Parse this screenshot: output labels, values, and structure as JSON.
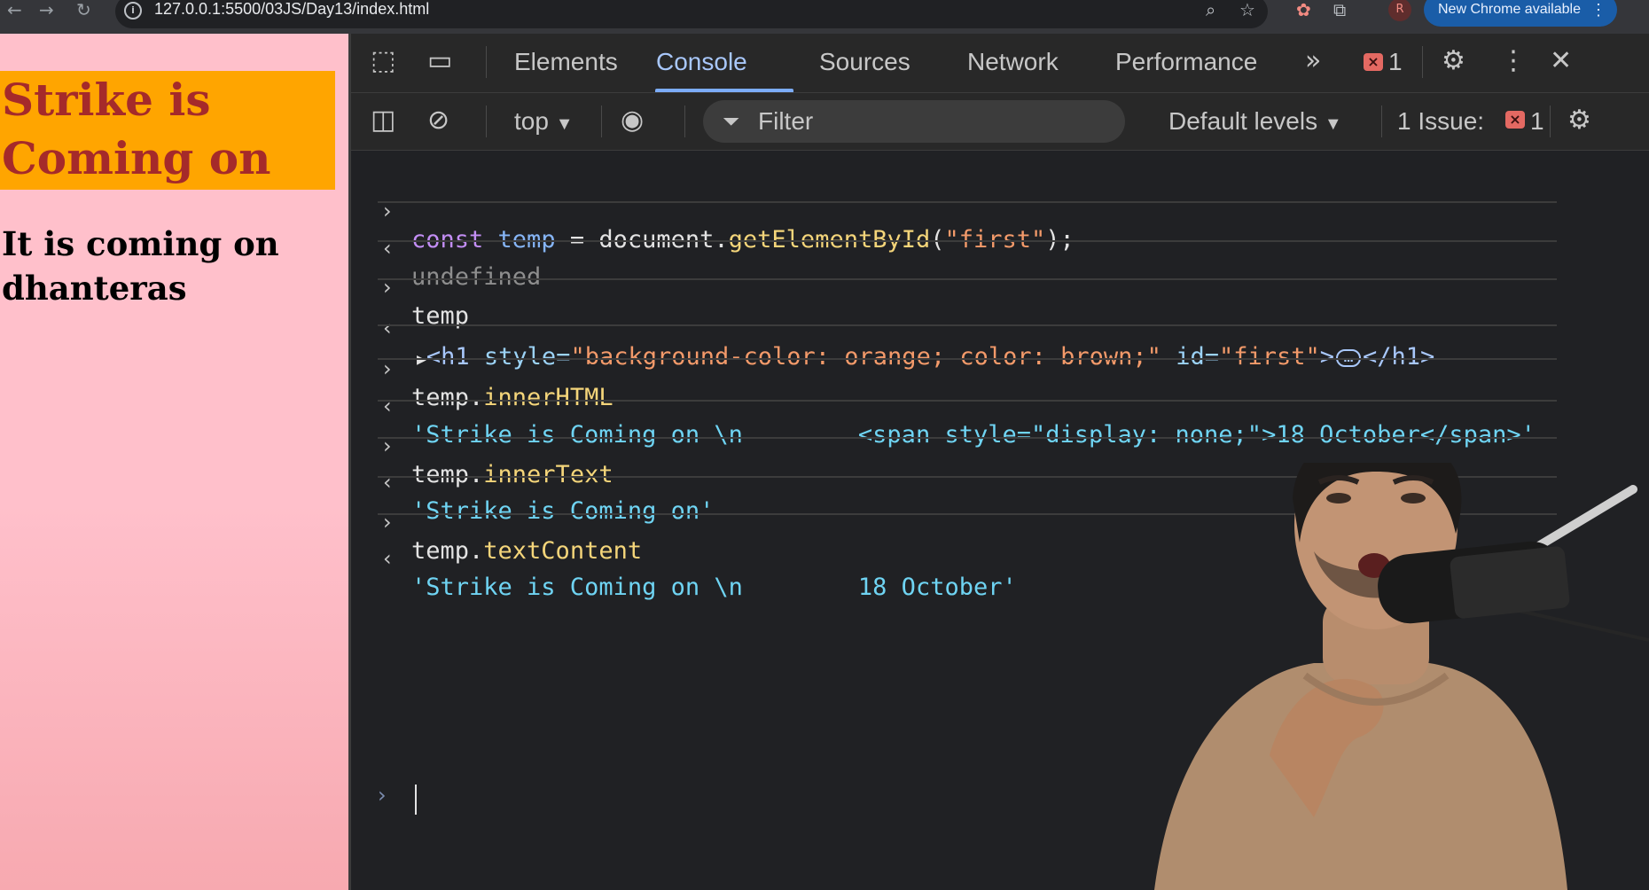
{
  "browser": {
    "url": "127.0.0.1:5500/03JS/Day13/index.html",
    "profile_initial": "R",
    "update_label": "New Chrome available"
  },
  "page": {
    "heading": "Strike is Coming on",
    "paragraph": "It is coming on dhanteras"
  },
  "devtools": {
    "tabs": [
      "Elements",
      "Console",
      "Sources",
      "Network",
      "Performance"
    ],
    "active_tab": "Console",
    "error_count": "1",
    "toolbar": {
      "context": "top",
      "filter_placeholder": "Filter",
      "levels": "Default levels",
      "issues_label": "1 Issue:",
      "issues_count": "1"
    },
    "console": {
      "lines": [
        {
          "kind": "input",
          "text": "const temp = document.getElementById(\"first\");"
        },
        {
          "kind": "output",
          "text": "undefined"
        },
        {
          "kind": "input",
          "text": "temp"
        },
        {
          "kind": "output",
          "text": "<h1 style=\"background-color: orange; color: brown;\" id=\"first\">…</h1>"
        },
        {
          "kind": "input",
          "text": "temp.innerHTML"
        },
        {
          "kind": "output",
          "text": "'Strike is Coming on \\n        <span style=\"display: none;\">18 October</span>'"
        },
        {
          "kind": "input",
          "text": "temp.innerText"
        },
        {
          "kind": "output",
          "text": "'Strike is Coming on'"
        },
        {
          "kind": "input",
          "text": "temp.textContent"
        },
        {
          "kind": "output",
          "text": "'Strike is Coming on \\n        18 October'"
        }
      ]
    }
  },
  "colors": {
    "page_bg": "#ffc0cb",
    "heading_bg": "#ffa500",
    "heading_fg": "#a52a2a",
    "devtools_bg": "#202124",
    "accent": "#a8c7fa"
  }
}
